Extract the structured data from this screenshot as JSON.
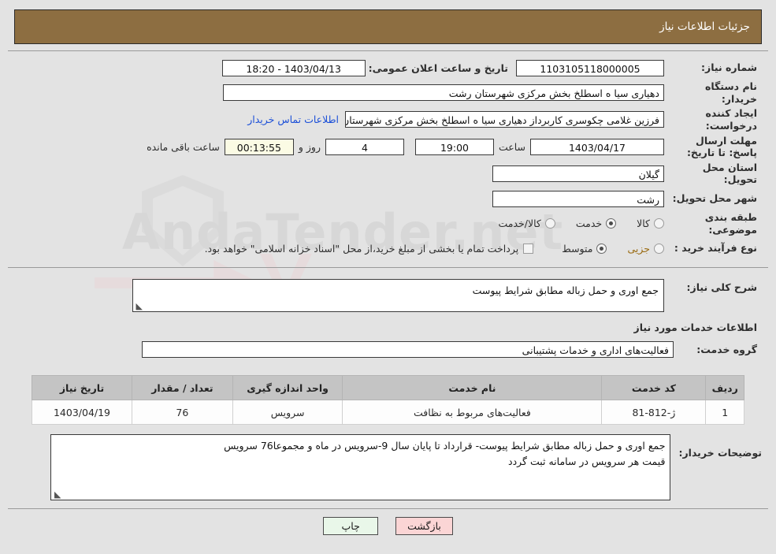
{
  "header": {
    "title": "جزئیات اطلاعات نیاز"
  },
  "form": {
    "need_number_label": "شماره نیاز:",
    "need_number_value": "1103105118000005",
    "public_announce_label": "تاریخ و ساعت اعلان عمومی:",
    "public_announce_value": "1403/04/13 - 18:20",
    "buyer_org_label": "نام دستگاه خریدار:",
    "buyer_org_value": "دهیاری سیا ه اسطلخ بخش مرکزی شهرستان رشت",
    "creator_label": "ایجاد کننده درخواست:",
    "creator_value": "فرزین غلامی چکوسری کاربرداز دهیاری سیا ه اسطلخ بخش مرکزی شهرستان ر",
    "contact_link": "اطلاعات تماس خریدار",
    "deadline_label": "مهلت ارسال پاسخ: تا تاریخ:",
    "deadline_date": "1403/04/17",
    "deadline_hour_label": "ساعت",
    "deadline_time": "19:00",
    "remaining_days": "4",
    "days_and_label": "روز و",
    "remaining_timer": "00:13:55",
    "remaining_suffix": "ساعت باقی مانده",
    "province_label": "استان محل تحویل:",
    "province_value": "گیلان",
    "city_label": "شهر محل تحویل:",
    "city_value": "رشت",
    "category_label": "طبقه بندی موضوعی:",
    "category_options": [
      {
        "label": "کالا",
        "checked": false
      },
      {
        "label": "خدمت",
        "checked": true
      },
      {
        "label": "کالا/خدمت",
        "checked": false
      }
    ],
    "process_label": "نوع فرآیند خرید :",
    "process_options": [
      {
        "label": "جزیی",
        "checked": false
      },
      {
        "label": "متوسط",
        "checked": true
      }
    ],
    "treasury_checkbox_text": "پرداخت تمام یا بخشی از مبلغ خرید،از محل \"اسناد خزانه اسلامی\" خواهد بود.",
    "treasury_checked": false
  },
  "description": {
    "label": "شرح کلی نیاز:",
    "value": "جمع اوری و حمل زباله مطابق شرایط پیوست"
  },
  "services_section": {
    "title": "اطلاعات خدمات مورد نیاز",
    "group_label": "گروه خدمت:",
    "group_value": "فعالیت‌های اداری و خدمات پشتیبانی"
  },
  "items_table": {
    "columns": [
      "ردیف",
      "کد خدمت",
      "نام خدمت",
      "واحد اندازه گیری",
      "تعداد / مقدار",
      "تاریخ نیاز"
    ],
    "rows": [
      {
        "row": "1",
        "code": "ژ-812-81",
        "name": "فعالیت‌های مربوط به نظافت",
        "unit": "سرویس",
        "quantity": "76",
        "need_date": "1403/04/19"
      }
    ]
  },
  "buyer_notes": {
    "label": "توضیحات خریدار:",
    "line1": "جمع اوری و حمل زباله مطابق شرایط پیوست- قرارداد تا پایان سال 9-سرویس در ماه و مجموعا76 سرویس",
    "line2": "قیمت هر سرویس در سامانه ثبت گردد"
  },
  "footer": {
    "print_label": "چاپ",
    "back_label": "بازگشت"
  },
  "watermark": {
    "text": "AndaTender.net"
  },
  "colors": {
    "header_bg": "#8d6e41",
    "table_header_bg": "#c4c4c4",
    "link": "#1b4fd8",
    "timer_bg": "#fbfbe4",
    "print_btn_bg": "#e9f7e9",
    "back_btn_bg": "#fbd5d5",
    "page_bg": "#e3e3e3"
  }
}
